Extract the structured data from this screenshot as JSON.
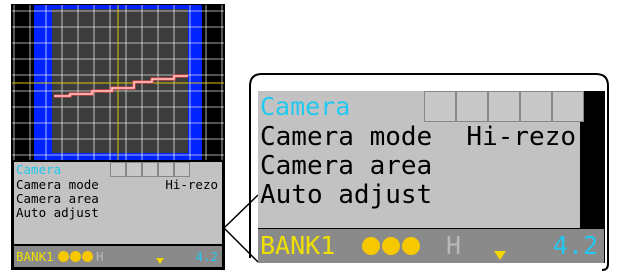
{
  "menu": {
    "title": "Camera",
    "items": [
      {
        "label": "Camera mode",
        "value": "Hi-rezo"
      },
      {
        "label": "Camera area",
        "value": ""
      },
      {
        "label": "Auto adjust",
        "value": ""
      }
    ]
  },
  "status": {
    "bank": "BANK1",
    "mark": "H",
    "version": "4.2"
  },
  "colors": {
    "title_cyan": "#22c8f0",
    "status_yellow": "#f0e000",
    "camera_area_blue": "#0022ff",
    "grid_yellow": "#d8c800",
    "laser_red": "#ff4040"
  }
}
